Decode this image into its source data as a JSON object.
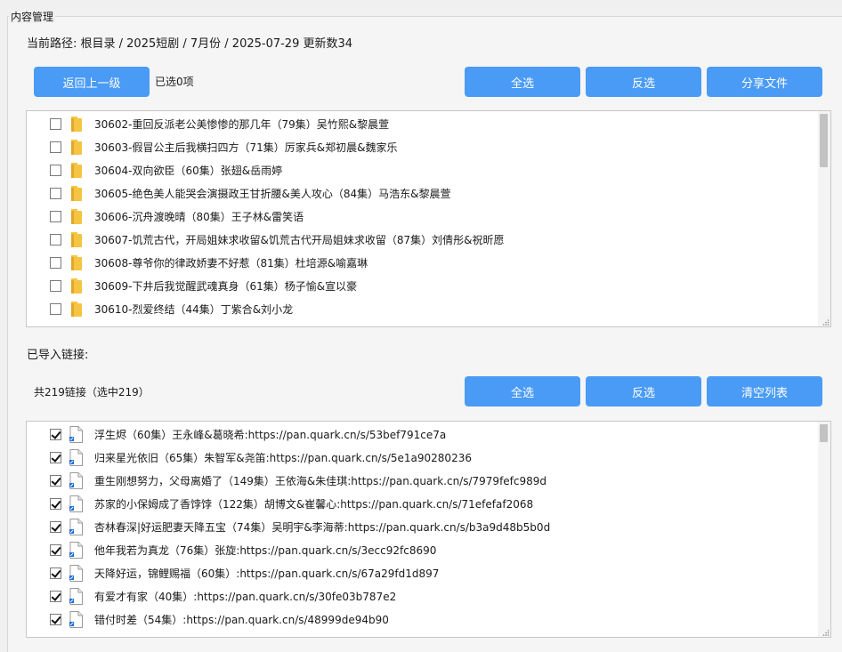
{
  "section_title": "内容管理",
  "path_text": "当前路径: 根目录 / 2025短剧 / 7月份 / 2025-07-29 更新数34",
  "top_bar": {
    "back_label": "返回上一级",
    "selected_count": "已选0项",
    "select_all_label": "全选",
    "invert_label": "反选",
    "share_label": "分享文件"
  },
  "folders": [
    "30602-重回反派老公美惨惨的那几年（79集）吴竹熙&黎晨萱",
    "30603-假冒公主后我横扫四方（71集）厉家兵&郑初晨&魏家乐",
    "30604-双向欲臣（60集）张翅&岳雨婷",
    "30605-绝色美人能哭会演摄政王甘折腰&美人攻心（84集）马浩东&黎晨萱",
    "30606-沉舟渡晚晴（80集）王子林&雷笑语",
    "30607-饥荒古代，开局姐妹求收留&饥荒古代开局姐妹求收留（87集）刘倩彤&祝昕愿",
    "30608-尊爷你的律政娇妻不好惹（81集）杜培源&喻嘉琳",
    "30609-下井后我觉醒武魂真身（61集）杨子愉&宣以豪",
    "30610-烈爱终结（44集）丁紫合&刘小龙"
  ],
  "links_section": {
    "title": "已导入链接:",
    "count_text": "共219链接（选中219）",
    "select_all_label": "全选",
    "invert_label": "反选",
    "clear_label": "清空列表"
  },
  "links": [
    "浮生烬（60集）王永峰&葛晓希:https://pan.quark.cn/s/53bef791ce7a",
    "归来星光依旧（65集）朱智军&尧笛:https://pan.quark.cn/s/5e1a90280236",
    "重生刚想努力，父母离婚了（149集）王依海&朱佳琪:https://pan.quark.cn/s/7979fefc989d",
    "苏家的小保姆成了香饽饽（122集）胡博文&崔馨心:https://pan.quark.cn/s/71efefaf2068",
    "杏林春深|好运肥妻天降五宝（74集）吴明宇&李海蒂:https://pan.quark.cn/s/b3a9d48b5b0d",
    "他年我若为真龙（76集）张旋:https://pan.quark.cn/s/3ecc92fc8690",
    "天降好运，锦鲤赐福（60集）:https://pan.quark.cn/s/67a29fd1d897",
    "有爱才有家（40集）:https://pan.quark.cn/s/30fe03b787e2",
    "错付时差（54集）:https://pan.quark.cn/s/48999de94b90"
  ],
  "colors": {
    "button": "#4a9bf5",
    "folder": "#f5c542",
    "file_icon_accent": "#1e6fd9"
  }
}
